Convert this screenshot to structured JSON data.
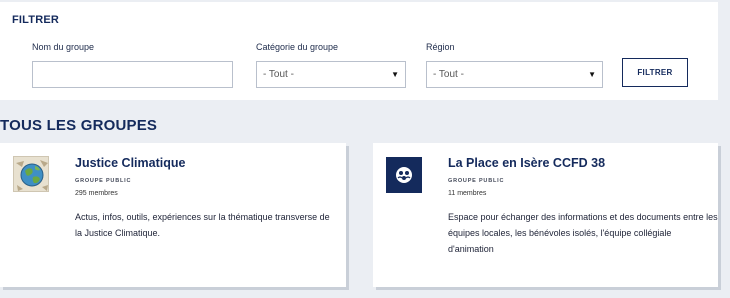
{
  "filter": {
    "title": "FILTRER",
    "group_name_label": "Nom du groupe",
    "group_name_value": "",
    "category_label": "Catégorie du groupe",
    "category_value": "- Tout -",
    "region_label": "Région",
    "region_value": "- Tout -",
    "button_label": "FILTRER"
  },
  "section_title": "TOUS LES GROUPES",
  "groups": [
    {
      "name": "Justice Climatique",
      "type": "GROUPE PUBLIC",
      "members": "295 membres",
      "description": "Actus, infos, outils, expériences sur la thématique transverse de la Justice Climatique.",
      "thumbnail": "globe-image"
    },
    {
      "name": "La Place en Isère CCFD 38",
      "type": "GROUPE PUBLIC",
      "members": "11 membres",
      "description": "Espace pour échanger des informations et des documents entre les équipes locales, les bénévoles isolés, l'équipe collégiale d'animation",
      "thumbnail": "group-icon"
    }
  ],
  "colors": {
    "brand": "#142a5c",
    "background": "#ebeef3"
  }
}
